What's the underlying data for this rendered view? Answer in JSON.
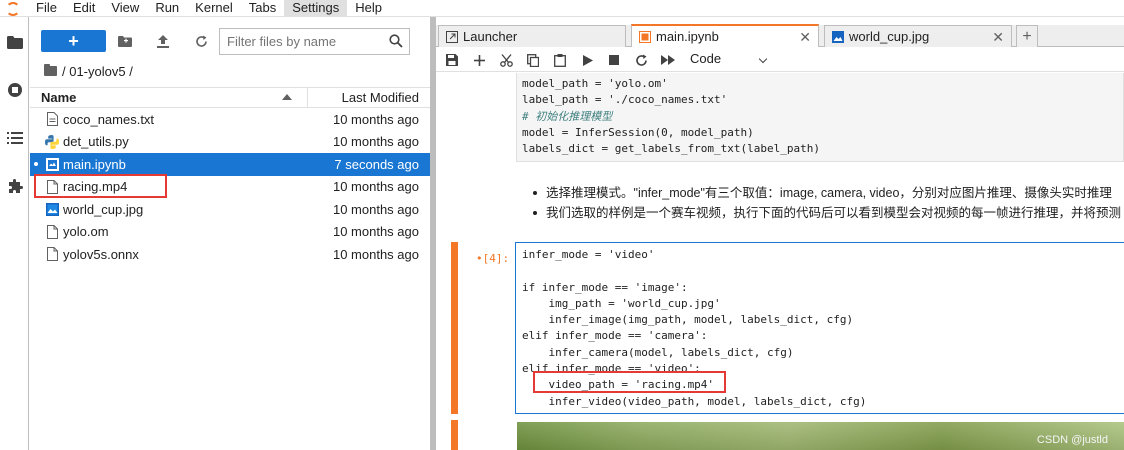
{
  "menubar": {
    "items": [
      "File",
      "Edit",
      "View",
      "Run",
      "Kernel",
      "Tabs",
      "Settings",
      "Help"
    ],
    "active_item": "Settings"
  },
  "sidebar": {
    "icons": [
      "folder-icon",
      "running-icon",
      "toc-icon",
      "extension-icon"
    ]
  },
  "filebrowser": {
    "new_label": "+",
    "filter_placeholder": "Filter files by name",
    "breadcrumb": "/ 01-yolov5 /",
    "header": {
      "name": "Name",
      "modified": "Last Modified"
    },
    "files": [
      {
        "name": "coco_names.txt",
        "modified": "10 months ago",
        "icon": "text-file-icon",
        "selected": false
      },
      {
        "name": "det_utils.py",
        "modified": "10 months ago",
        "icon": "python-icon",
        "selected": false
      },
      {
        "name": "main.ipynb",
        "modified": "7 seconds ago",
        "icon": "notebook-icon",
        "selected": true
      },
      {
        "name": "racing.mp4",
        "modified": "10 months ago",
        "icon": "file-icon",
        "selected": false
      },
      {
        "name": "world_cup.jpg",
        "modified": "10 months ago",
        "icon": "image-icon",
        "selected": false
      },
      {
        "name": "yolo.om",
        "modified": "10 months ago",
        "icon": "file-icon",
        "selected": false
      },
      {
        "name": "yolov5s.onnx",
        "modified": "10 months ago",
        "icon": "file-icon",
        "selected": false
      }
    ]
  },
  "tabs": [
    {
      "label": "Launcher",
      "icon": "launcher-icon",
      "active": false
    },
    {
      "label": "main.ipynb",
      "icon": "notebook-icon",
      "active": true
    },
    {
      "label": "world_cup.jpg",
      "icon": "image-icon",
      "active": false
    }
  ],
  "notebook_toolbar": {
    "cell_type": "Code"
  },
  "cells": {
    "cell1_lines": [
      "model_path = 'yolo.om'",
      "label_path = './coco_names.txt'",
      "# 初始化推理模型",
      "model = InferSession(0, model_path)",
      "labels_dict = get_labels_from_txt(label_path)"
    ],
    "markdown_bullets": [
      "选择推理模式。\"infer_mode\"有三个取值：image, camera, video，分别对应图片推理、摄像头实时推理",
      "我们选取的样例是一个赛车视频，执行下面的代码后可以看到模型会对视频的每一帧进行推理，并将预测"
    ],
    "cell2_prompt": "•[4]:",
    "cell2_lines": [
      "infer_mode = 'video'",
      "",
      "if infer_mode == 'image':",
      "    img_path = 'world_cup.jpg'",
      "    infer_image(img_path, model, labels_dict, cfg)",
      "elif infer_mode == 'camera':",
      "    infer_camera(model, labels_dict, cfg)",
      "elif infer_mode == 'video':",
      "    video_path = 'racing.mp4'",
      "    infer_video(video_path, model, labels_dict, cfg)"
    ]
  },
  "watermark": "CSDN @justld",
  "colors": {
    "accent": "#1976d2",
    "jupyter_orange": "#f37726",
    "highlight_red": "#e53935"
  }
}
